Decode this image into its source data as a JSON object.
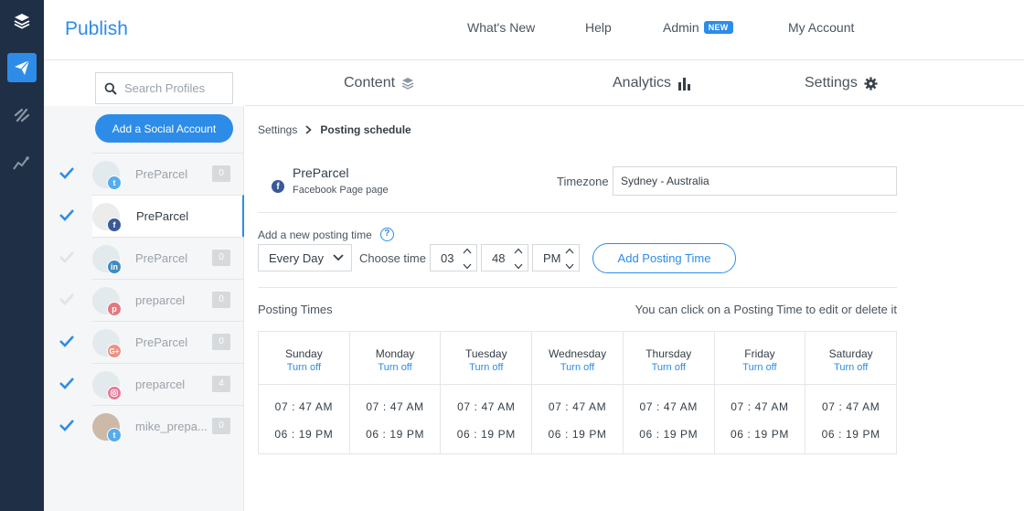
{
  "app": {
    "title": "Publish"
  },
  "rail": {
    "items": [
      {
        "icon": "layers-icon"
      },
      {
        "icon": "paper-plane-icon",
        "active": true
      },
      {
        "icon": "reply-icon"
      },
      {
        "icon": "trend-line-icon"
      }
    ]
  },
  "topnav": {
    "whats_new": "What's New",
    "help": "Help",
    "admin": "Admin",
    "admin_badge": "NEW",
    "my_account": "My Account"
  },
  "sidebar": {
    "search_placeholder": "Search Profiles",
    "add_button": "Add a Social Account",
    "profiles": [
      {
        "name": "PreParcel",
        "network": "twitter",
        "count": "0",
        "checked": true,
        "faded": true
      },
      {
        "name": "PreParcel",
        "network": "facebook",
        "checked": true,
        "active": true
      },
      {
        "name": "PreParcel",
        "network": "linkedin",
        "count": "0",
        "checked": false,
        "faded": true
      },
      {
        "name": "preparcel",
        "network": "pinterest",
        "count": "0",
        "checked": false,
        "faded": true
      },
      {
        "name": "PreParcel",
        "network": "google-plus",
        "count": "0",
        "checked": true,
        "faded": true
      },
      {
        "name": "preparcel",
        "network": "instagram",
        "count": "4",
        "checked": true,
        "faded": true
      },
      {
        "name": "mike_prepa...",
        "network": "twitter",
        "count": "0",
        "checked": true,
        "faded": true
      }
    ]
  },
  "tabs": {
    "content": "Content",
    "analytics": "Analytics",
    "settings": "Settings"
  },
  "breadcrumb": {
    "parent": "Settings",
    "current": "Posting schedule"
  },
  "profile_header": {
    "name": "PreParcel",
    "subtitle": "Facebook Page page",
    "timezone_label": "Timezone",
    "timezone_value": "Sydney - Australia"
  },
  "add_time": {
    "label": "Add a new posting time",
    "day_value": "Every Day",
    "choose_label": "Choose time",
    "hour": "03",
    "minute": "48",
    "ampm": "PM",
    "button": "Add Posting Time"
  },
  "posting_times": {
    "title": "Posting Times",
    "hint": "You can click on a Posting Time to edit or delete it",
    "turn_off": "Turn off",
    "days": [
      {
        "day": "Sunday",
        "turn_off": "Turn off",
        "times": [
          "07 : 47  AM",
          "06 : 19  PM"
        ]
      },
      {
        "day": "Monday",
        "turn_off": "Turn off",
        "times": [
          "07 : 47  AM",
          "06 : 19  PM"
        ]
      },
      {
        "day": "Tuesday",
        "turn_off": "Turn off",
        "times": [
          "07 : 47  AM",
          "06 : 19  PM"
        ]
      },
      {
        "day": "Wednesday",
        "turn_off": "Turn off",
        "times": [
          "07 : 47  AM",
          "06 : 19  PM"
        ]
      },
      {
        "day": "Thursday",
        "turn_off": "Turn off",
        "times": [
          "07 : 47  AM",
          "06 : 19  PM"
        ]
      },
      {
        "day": "Friday",
        "turn_off": "Turn off",
        "times": [
          "07 : 47  AM",
          "06 : 19  PM"
        ]
      },
      {
        "day": "Saturday",
        "turn_off": "Turn off",
        "times": [
          "07 : 47  AM",
          "06 : 19  PM"
        ]
      }
    ]
  },
  "colors": {
    "accent": "#2c8ce8",
    "rail": "#1f2f46",
    "twitter": "#55acee",
    "facebook": "#3b5998",
    "linkedin": "#0077b5",
    "pinterest": "#cb2027",
    "google_plus": "#dd4b39",
    "instagram": "#e1306c"
  }
}
